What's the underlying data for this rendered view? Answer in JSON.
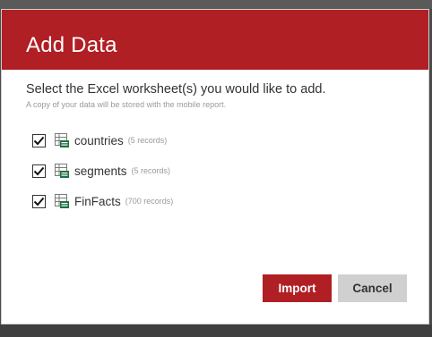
{
  "dialog": {
    "title": "Add Data",
    "instruction": "Select the Excel worksheet(s) you would like to add.",
    "note": "A copy of your data will be stored with the mobile report.",
    "sheets": [
      {
        "name": "countries",
        "count": "(5 records)",
        "checked": true
      },
      {
        "name": "segments",
        "count": "(5 records)",
        "checked": true
      },
      {
        "name": "FinFacts",
        "count": "(700 records)",
        "checked": true
      }
    ],
    "buttons": {
      "import_label": "Import",
      "cancel_label": "Cancel"
    }
  },
  "colors": {
    "accent": "#b01f24",
    "cancel_bg": "#d0d0d0",
    "excel_green": "#1e7145"
  },
  "icons": {
    "checkbox": "checkmark-icon",
    "sheet": "excel-xls-icon"
  }
}
